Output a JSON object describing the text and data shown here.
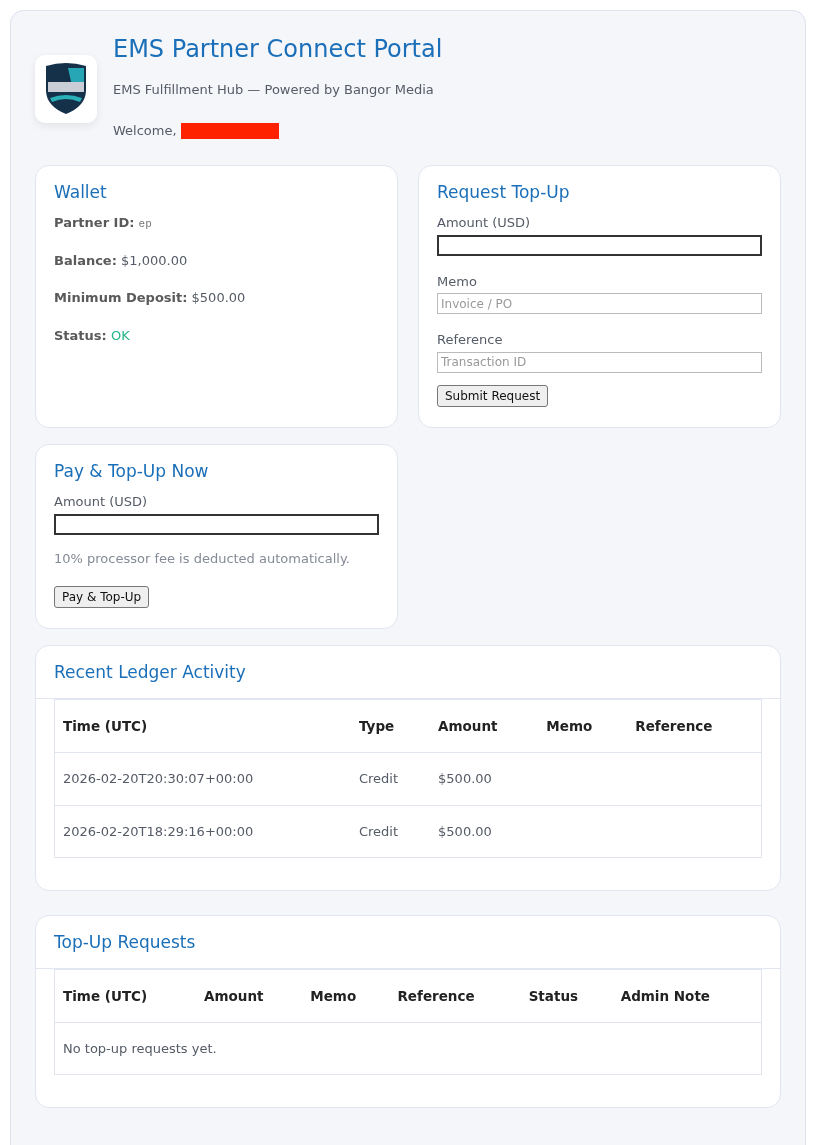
{
  "header": {
    "title": "EMS Partner Connect Portal",
    "subtitle": "EMS Fulfillment Hub — Powered by Bangor Media",
    "welcome": "Welcome,",
    "name_redacted": true
  },
  "wallet": {
    "title": "Wallet",
    "fields": [
      {
        "label": "Partner ID:",
        "value": "ep",
        "kind": "mono"
      },
      {
        "label": "Balance:",
        "value": "$1,000.00",
        "kind": "plain"
      },
      {
        "label": "Minimum Deposit:",
        "value": "$500.00",
        "kind": "plain"
      },
      {
        "label": "Status:",
        "value": "OK",
        "kind": "ok"
      }
    ]
  },
  "request_topup": {
    "title": "Request Top-Up",
    "fields": [
      {
        "label": "Amount (USD)",
        "focused": true
      },
      {
        "label": "Memo",
        "placeholder": "Invoice / PO",
        "focused": false
      },
      {
        "label": "Reference",
        "placeholder": "Transaction ID",
        "focused": false
      }
    ],
    "button": "Submit Request"
  },
  "pay_topup": {
    "title": "Pay & Top-Up Now",
    "fields": [
      {
        "label": "Amount (USD)",
        "focused": true
      }
    ],
    "note": "10% processor fee is deducted automatically.",
    "button": "Pay & Top-Up"
  },
  "ledger": {
    "title": "Recent Ledger Activity",
    "columns": [
      "Time (UTC)",
      "Type",
      "Amount",
      "Memo",
      "Reference"
    ],
    "rows": [
      [
        "2026-02-20T20:30:07+00:00",
        "Credit",
        "$500.00"
      ],
      [
        "2026-02-20T18:29:16+00:00",
        "Credit",
        "$500.00"
      ]
    ]
  },
  "requests": {
    "title": "Top-Up Requests",
    "columns": [
      "Time (UTC)",
      "Amount",
      "Memo",
      "Reference",
      "Status",
      "Admin Note"
    ],
    "empty": "No top-up requests yet."
  }
}
